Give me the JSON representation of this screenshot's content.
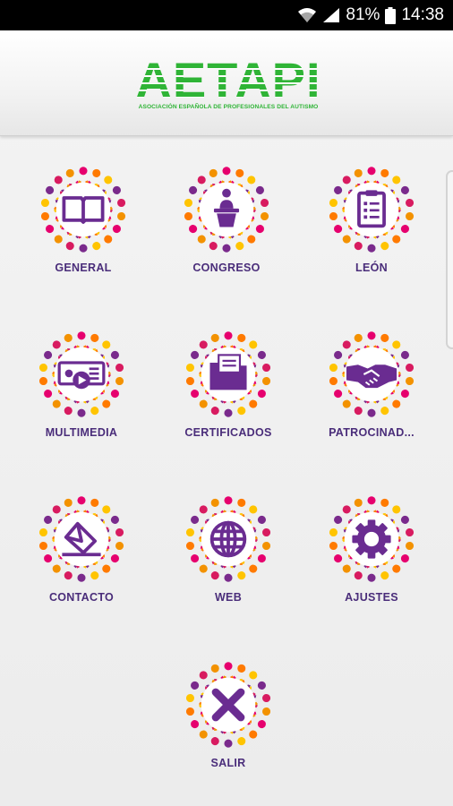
{
  "status_bar": {
    "battery_percent": "81%",
    "time": "14:38",
    "icons": [
      "wifi-icon",
      "signal-icon",
      "battery-icon"
    ]
  },
  "header": {
    "logo_text": "AETAPI",
    "logo_subtitle": "ASOCIACIÓN ESPAÑOLA DE PROFESIONALES DEL AUTISMO",
    "logo_color": "#2fb436"
  },
  "menu": {
    "items": [
      {
        "label": "GENERAL",
        "icon": "book-icon"
      },
      {
        "label": "CONGRESO",
        "icon": "speaker-podium-icon"
      },
      {
        "label": "LEÓN",
        "icon": "clipboard-icon"
      },
      {
        "label": "MULTIMEDIA",
        "icon": "media-icon"
      },
      {
        "label": "CERTIFICADOS",
        "icon": "folder-icon"
      },
      {
        "label": "PATROCINAD...",
        "icon": "handshake-icon"
      },
      {
        "label": "CONTACTO",
        "icon": "envelope-icon"
      },
      {
        "label": "WEB",
        "icon": "globe-icon"
      },
      {
        "label": "AJUSTES",
        "icon": "gear-icon"
      },
      {
        "label": "SALIR",
        "icon": "close-icon"
      }
    ]
  },
  "colors": {
    "icon_purple": "#6a2c91",
    "label": "#4a2d7a",
    "ring": [
      "#e6006e",
      "#ff7a00",
      "#ffc400",
      "#7a2a8c",
      "#d81b60",
      "#f39200"
    ]
  }
}
